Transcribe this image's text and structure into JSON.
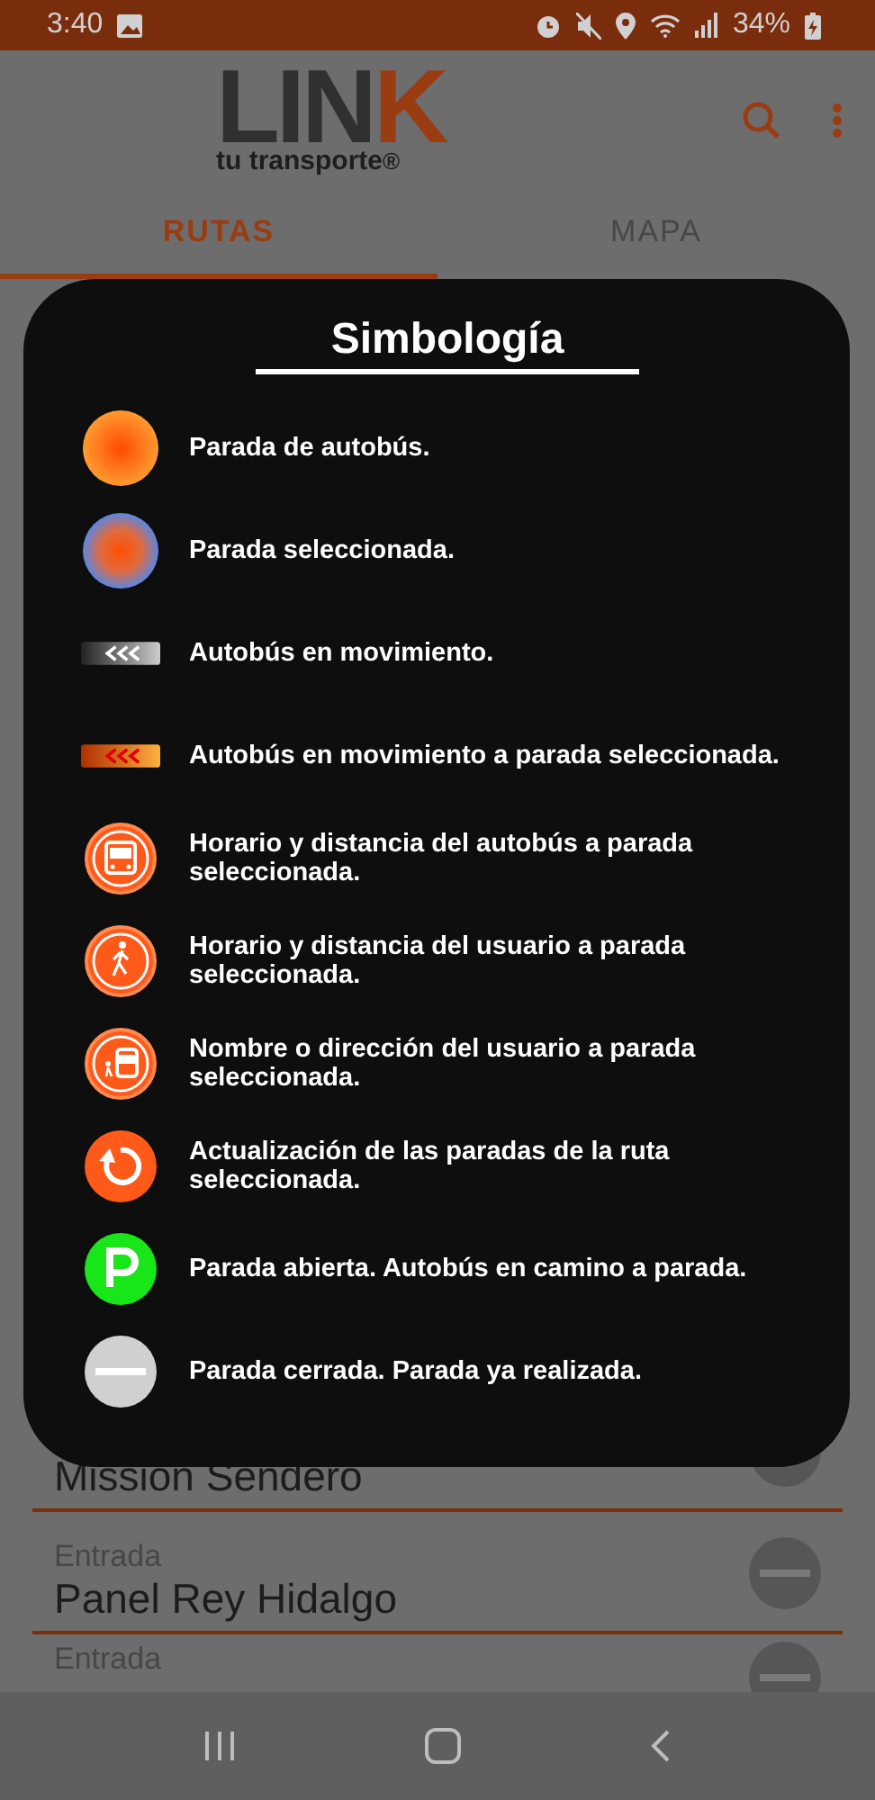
{
  "status_bar": {
    "time": "3:40",
    "battery": "34%"
  },
  "app_bar": {
    "logo": {
      "text": "LIN",
      "accent": "K",
      "tagline": "tu transporte",
      "mark": "®"
    }
  },
  "tabs": [
    {
      "label": "RUTAS",
      "selected": true
    },
    {
      "label": "MAPA",
      "selected": false
    }
  ],
  "stops": [
    {
      "name": "Mission Sendero",
      "closed": true
    },
    {
      "label": "Entrada",
      "name": "Panel Rey Hidalgo",
      "closed": true
    },
    {
      "label": "Entrada",
      "closed": true
    }
  ],
  "dialog": {
    "title": "Simbología",
    "items": [
      {
        "kind": "stop",
        "text": "Parada de autobús."
      },
      {
        "kind": "selected-stop",
        "text": "Parada seleccionada."
      },
      {
        "kind": "bus-moving",
        "text": "Autobús en movimiento."
      },
      {
        "kind": "bus-moving-selected",
        "text": "Autobús en movimiento a parada seleccionada."
      },
      {
        "kind": "bus-time",
        "text": "Horario y distancia del autobús a parada seleccionada."
      },
      {
        "kind": "walk-time",
        "text": "Horario y distancia del usuario a parada seleccionada."
      },
      {
        "kind": "user-address",
        "text": "Nombre o dirección del usuario a parada seleccionada."
      },
      {
        "kind": "refresh",
        "text": "Actualización de las paradas de la ruta seleccionada."
      },
      {
        "kind": "open",
        "text": "Parada abierta. Autobús en camino a parada."
      },
      {
        "kind": "closed",
        "text": "Parada cerrada. Parada ya realizada."
      }
    ]
  }
}
